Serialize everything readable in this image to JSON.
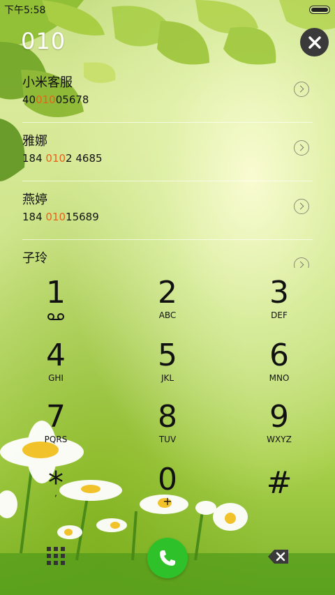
{
  "status": {
    "time": "下午5:58"
  },
  "dialer": {
    "input": "010"
  },
  "results": [
    {
      "name": "小米客服",
      "num_pre": "40",
      "num_match": "010",
      "num_post": "05678"
    },
    {
      "name": "雅娜",
      "num_pre": "184 ",
      "num_match": "010",
      "num_post": "2 4685"
    },
    {
      "name": "燕婷",
      "num_pre": "184 ",
      "num_match": "010",
      "num_post": "15689"
    },
    {
      "name": "子玲",
      "num_pre": "",
      "num_match": "",
      "num_post": ""
    }
  ],
  "keypad": [
    {
      "digit": "1",
      "letters": ""
    },
    {
      "digit": "2",
      "letters": "ABC"
    },
    {
      "digit": "3",
      "letters": "DEF"
    },
    {
      "digit": "4",
      "letters": "GHI"
    },
    {
      "digit": "5",
      "letters": "JKL"
    },
    {
      "digit": "6",
      "letters": "MNO"
    },
    {
      "digit": "7",
      "letters": "PQRS"
    },
    {
      "digit": "8",
      "letters": "TUV"
    },
    {
      "digit": "9",
      "letters": "WXYZ"
    },
    {
      "digit": "*",
      "letters": ","
    },
    {
      "digit": "0",
      "letters": "+"
    },
    {
      "digit": "#",
      "letters": ""
    }
  ],
  "icons": {
    "close": "close-icon",
    "voicemail": "voicemail-icon",
    "keypad_toggle": "keypad-grid-icon",
    "call": "phone-icon",
    "backspace": "backspace-icon"
  },
  "colors": {
    "match_highlight": "#e8621a",
    "call_button": "#2fc12a",
    "close_button": "#3a3a3a"
  }
}
